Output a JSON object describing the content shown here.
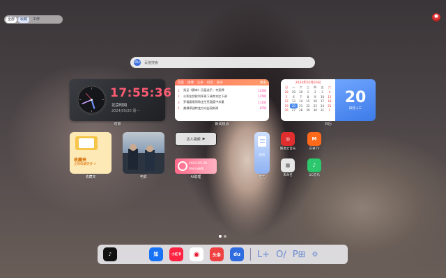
{
  "topbar": {
    "items": [
      "全部",
      "收藏",
      "工作"
    ]
  },
  "search": {
    "placeholder": "百度搜索"
  },
  "clock": {
    "time": "17:55:36",
    "timezone": "北京时间",
    "date": "2024/05/20 周一",
    "label": "时钟"
  },
  "news": {
    "tabs": [
      "百度",
      "微博",
      "头条",
      "抖音",
      "知乎"
    ],
    "more": "更多",
    "rows": [
      {
        "n": "1",
        "title": "男足《赛车》历届选手，夺奖牌",
        "heat": "145W"
      },
      {
        "n": "2",
        "title": "公积金贷款利率再下调并对比下调",
        "heat": "125W"
      },
      {
        "n": "3",
        "title": "罗福度假同款出生亮温度中米量",
        "heat": "111W"
      },
      {
        "n": "4",
        "title": "美俄停战转变方向出现新闻",
        "heat": "87W"
      }
    ],
    "label": "新闻热点"
  },
  "calendar": {
    "title": "2024年05月20日",
    "weekdays": [
      "日",
      "一",
      "二",
      "三",
      "四",
      "五",
      "六"
    ],
    "weeks": [
      [
        "28",
        "29",
        "30",
        "1",
        "2",
        "3",
        "4"
      ],
      [
        "5",
        "6",
        "7",
        "8",
        "9",
        "10",
        "11"
      ],
      [
        "12",
        "13",
        "14",
        "15",
        "16",
        "17",
        "18"
      ],
      [
        "19",
        "20",
        "21",
        "22",
        "23",
        "24",
        "25"
      ],
      [
        "26",
        "27",
        "28",
        "29",
        "30",
        "31",
        "1"
      ]
    ],
    "today": "20",
    "big_day": "20",
    "lunar": "四月十三",
    "label": "日历"
  },
  "favorites": {
    "title": "收藏夹",
    "subtitle": "立即收藏更多 >",
    "label": "收藏夹"
  },
  "movie": {
    "label": "电影"
  },
  "human_video": {
    "text": "达人视频"
  },
  "ai": {
    "line1": "2024-05-20",
    "line2": "Wellsa新版",
    "label": "AI助理"
  },
  "lala": {
    "text": "拉拉",
    "label": "拉力"
  },
  "apps": [
    {
      "name": "网易云音乐",
      "color": "#e02d2d",
      "glyph": "◎"
    },
    {
      "name": "芒果TV",
      "color": "#ff6a1a",
      "glyph": "M"
    },
    {
      "name": "未命名",
      "color": "#e6e6e6",
      "glyph": "▦"
    },
    {
      "name": "QQ音乐",
      "color": "#2dc76d",
      "glyph": "♪"
    }
  ],
  "dock": [
    {
      "name": "抖音",
      "color": "#111",
      "glyph": "♪"
    },
    {
      "name": "知乎",
      "color": "#1772f6",
      "glyph": "知"
    },
    {
      "name": "小红书",
      "color": "#ff2442",
      "glyph": "小红书"
    },
    {
      "name": "微博",
      "color": "#ffffff",
      "glyph": "◉"
    },
    {
      "name": "头条",
      "color": "#f04142",
      "glyph": "头条"
    },
    {
      "name": "百度",
      "color": "#2f6ce0",
      "glyph": "du"
    }
  ]
}
